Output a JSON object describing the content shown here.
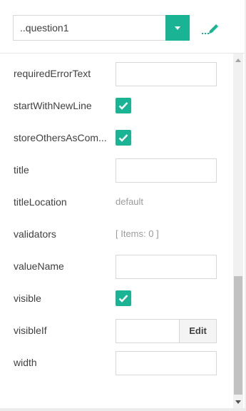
{
  "header": {
    "selected_object": "..question1",
    "accent_color": "#1ab394",
    "dropdown_icon": "chevron-down-icon",
    "edit_icon": "pencil-icon"
  },
  "properties": [
    {
      "label": "requiredErrorText",
      "kind": "input",
      "value": ""
    },
    {
      "label": "startWithNewLine",
      "kind": "checkbox",
      "checked": true
    },
    {
      "label": "storeOthersAsCom...",
      "kind": "checkbox",
      "checked": true
    },
    {
      "label": "title",
      "kind": "input",
      "value": ""
    },
    {
      "label": "titleLocation",
      "kind": "text",
      "value": "default"
    },
    {
      "label": "validators",
      "kind": "text",
      "value": "[ Items: 0 ]"
    },
    {
      "label": "valueName",
      "kind": "input",
      "value": ""
    },
    {
      "label": "visible",
      "kind": "checkbox",
      "checked": true
    },
    {
      "label": "visibleIf",
      "kind": "input-button",
      "value": "",
      "button": "Edit"
    },
    {
      "label": "width",
      "kind": "input",
      "value": ""
    }
  ]
}
